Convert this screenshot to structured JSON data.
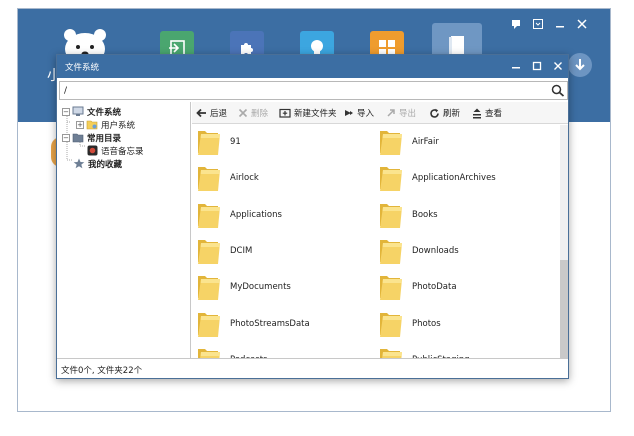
{
  "app": {
    "title_fragment": "小",
    "toolbar_icons": [
      "import-icon",
      "puzzle-icon",
      "lightbulb-icon",
      "grid-apps-icon",
      "book-icon"
    ],
    "window_controls": [
      "feedback-icon",
      "menu-icon",
      "minimize-icon",
      "close-icon"
    ]
  },
  "dialog": {
    "title": "文件系统",
    "path_value": "/",
    "path_placeholder": ""
  },
  "tree": {
    "items": [
      {
        "label": "文件系统",
        "icon": "computer-icon",
        "bold": true,
        "expander": "−"
      },
      {
        "label": "用户系统",
        "icon": "folder-user-icon",
        "bold": false,
        "expander": "+"
      },
      {
        "label": "常用目录",
        "icon": "folder-icon",
        "bold": true,
        "expander": "−"
      },
      {
        "label": "语音备忘录",
        "icon": "voice-memo-icon",
        "bold": false,
        "expander": ""
      },
      {
        "label": "我的收藏",
        "icon": "star-icon",
        "bold": true,
        "expander": ""
      }
    ]
  },
  "toolbar": {
    "back": "后退",
    "delete": "删除",
    "new_folder": "新建文件夹",
    "import": "导入",
    "export": "导出",
    "refresh": "刷新",
    "view": "查看"
  },
  "files": [
    "91",
    "AirFair",
    "Airlock",
    "ApplicationArchives",
    "Applications",
    "Books",
    "DCIM",
    "Downloads",
    "MyDocuments",
    "PhotoData",
    "PhotoStreamsData",
    "Photos",
    "Podcasts",
    "PublicStaging"
  ],
  "status": {
    "text": "文件0个, 文件夹22个"
  },
  "colors": {
    "header_blue": "#3c6ea3",
    "folder_yellow": "#f4cf5a"
  }
}
